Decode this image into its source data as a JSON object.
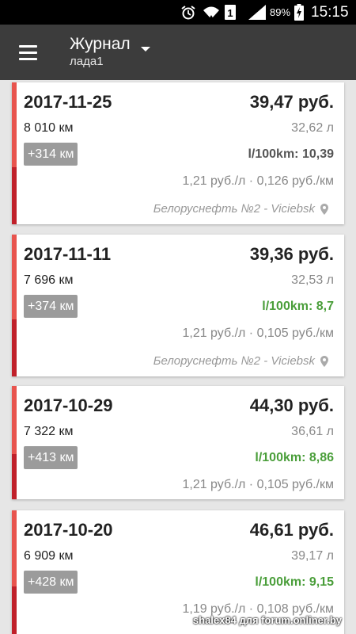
{
  "status_bar": {
    "battery": "89%",
    "sim": "1",
    "time": "15:15",
    "icons": [
      "alarm-icon",
      "wifi-icon",
      "sim-icon",
      "signal-icon",
      "battery-icon"
    ]
  },
  "app_bar": {
    "title": "Журнал",
    "subtitle": "лада1",
    "background": "#3c3c3c"
  },
  "colors": {
    "good": "#4a9e3a",
    "neutral": "#555555",
    "bar_top": "#e8544e",
    "bar_bottom": "#c0202a"
  },
  "entries": [
    {
      "date": "2017-11-25",
      "total": "39,47 руб.",
      "odometer": "8 010 км",
      "volume": "32,62 л",
      "delta": "+314 км",
      "consumption": "l/100km: 10,39",
      "consumption_status": "neutral",
      "prices": "1,21 руб./л · 0,126 руб./км",
      "station": "Белоруснефть №2 - Viciebsk"
    },
    {
      "date": "2017-11-11",
      "total": "39,36 руб.",
      "odometer": "7 696 км",
      "volume": "32,53 л",
      "delta": "+374 км",
      "consumption": "l/100km: 8,7",
      "consumption_status": "good",
      "prices": "1,21 руб./л · 0,105 руб./км",
      "station": "Белоруснефть №2 - Viciebsk"
    },
    {
      "date": "2017-10-29",
      "total": "44,30 руб.",
      "odometer": "7 322 км",
      "volume": "36,61 л",
      "delta": "+413 км",
      "consumption": "l/100km: 8,86",
      "consumption_status": "good",
      "prices": "1,21 руб./л · 0,105 руб./км",
      "station": ""
    },
    {
      "date": "2017-10-20",
      "total": "46,61 руб.",
      "odometer": "6 909 км",
      "volume": "39,17 л",
      "delta": "+428 км",
      "consumption": "l/100km: 9,15",
      "consumption_status": "good",
      "prices": "1,19 руб./л · 0,108 руб./км",
      "station": ""
    }
  ],
  "watermark": "shalex84 для forum.onliner.by"
}
